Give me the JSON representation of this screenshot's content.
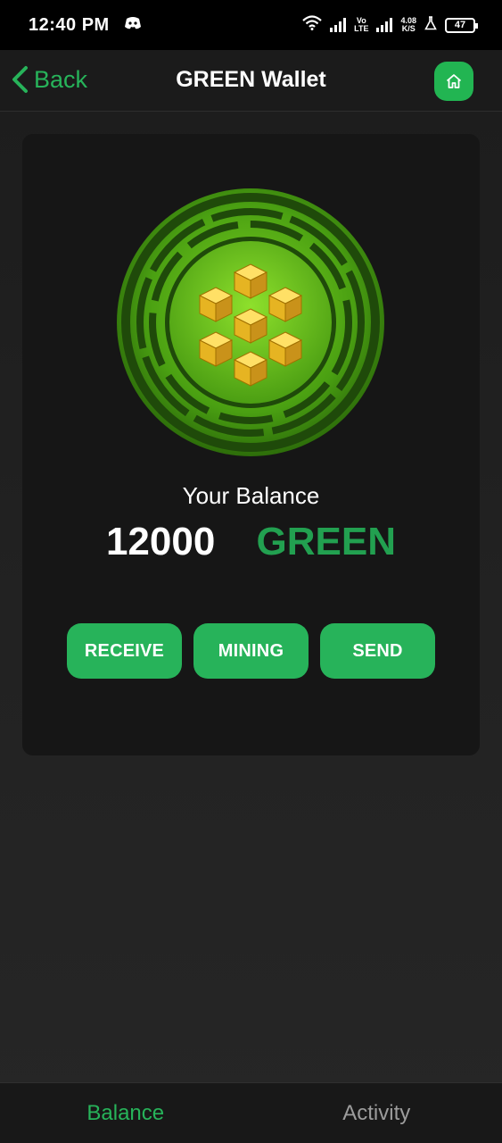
{
  "status_bar": {
    "time": "12:40 PM",
    "network_label_top": "Vo",
    "network_label_bottom": "LTE",
    "speed_top": "4.08",
    "speed_bottom": "K/S",
    "battery": "47",
    "icons": [
      "discord-icon",
      "wifi-icon",
      "signal-icon",
      "signal-icon",
      "flask-icon",
      "battery-icon"
    ]
  },
  "header": {
    "back_label": "Back",
    "title": "GREEN Wallet",
    "home_icon": "home-icon"
  },
  "wallet": {
    "balance_label": "Your Balance",
    "balance_amount": "12000",
    "currency": "GREEN",
    "actions": [
      "RECEIVE",
      "MINING",
      "SEND"
    ]
  },
  "bottom_nav": {
    "tabs": [
      {
        "label": "Balance",
        "active": true
      },
      {
        "label": "Activity",
        "active": false
      }
    ]
  },
  "colors": {
    "accent": "#27b35a",
    "currency_text": "#22a050",
    "background": "#1b1b1b",
    "card": "#161616",
    "inactive_tab": "#9c9c9c"
  }
}
